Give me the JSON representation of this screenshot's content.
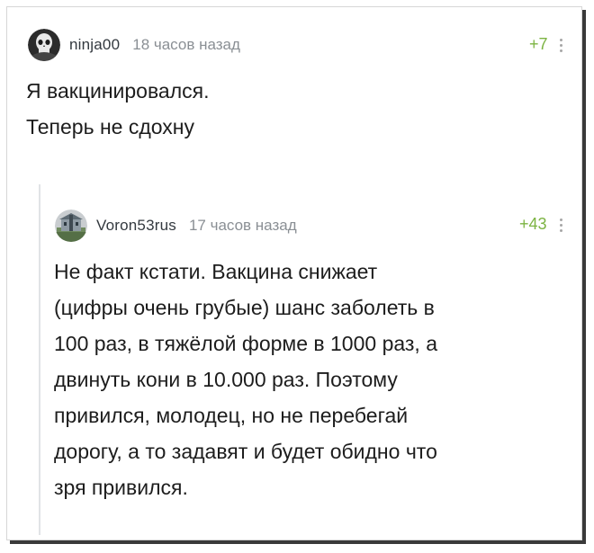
{
  "comment1": {
    "author": "ninja00",
    "time": "18 часов назад",
    "rating": "+7",
    "avatar_icon": "skull-avatar-icon",
    "lines": [
      "Я вакцинировался.",
      "Теперь не сдохну"
    ]
  },
  "comment2": {
    "author": "Voron53rus",
    "time": "17 часов назад",
    "rating": "+43",
    "avatar_icon": "building-avatar-icon",
    "lines": [
      "Не факт кстати. Вакцина снижает",
      "(цифры очень грубые) шанс заболеть в",
      "100 раз, в тяжёлой форме в 1000 раз, а",
      "двинуть кони в 10.000 раз. Поэтому",
      "привился, молодец, но не перебегай",
      "дорогу, а то задавят и будет обидно что",
      "зря привился."
    ]
  },
  "colors": {
    "rating": "#7cb342",
    "author": "#33393f",
    "time": "#8a8f94",
    "text": "#1d1d1d"
  }
}
